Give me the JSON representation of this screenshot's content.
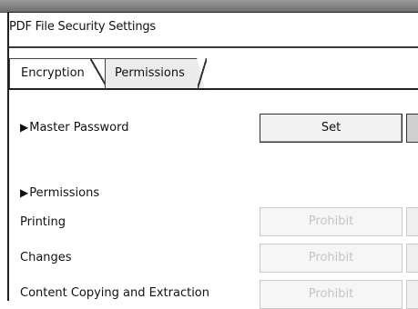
{
  "window": {
    "title": "PDF File Security Settings"
  },
  "tabs": [
    {
      "label": "Encryption"
    },
    {
      "label": "Permissions"
    }
  ],
  "master_password": {
    "label": "Master Password",
    "button": "Set"
  },
  "permissions": {
    "heading": "Permissions",
    "rows": [
      {
        "label": "Printing",
        "button": "Prohibit"
      },
      {
        "label": "Changes",
        "button": "Prohibit"
      },
      {
        "label": "Content Copying and Extraction",
        "button": "Prohibit"
      }
    ]
  },
  "icons": {
    "bullet": "right-triangle-icon"
  }
}
